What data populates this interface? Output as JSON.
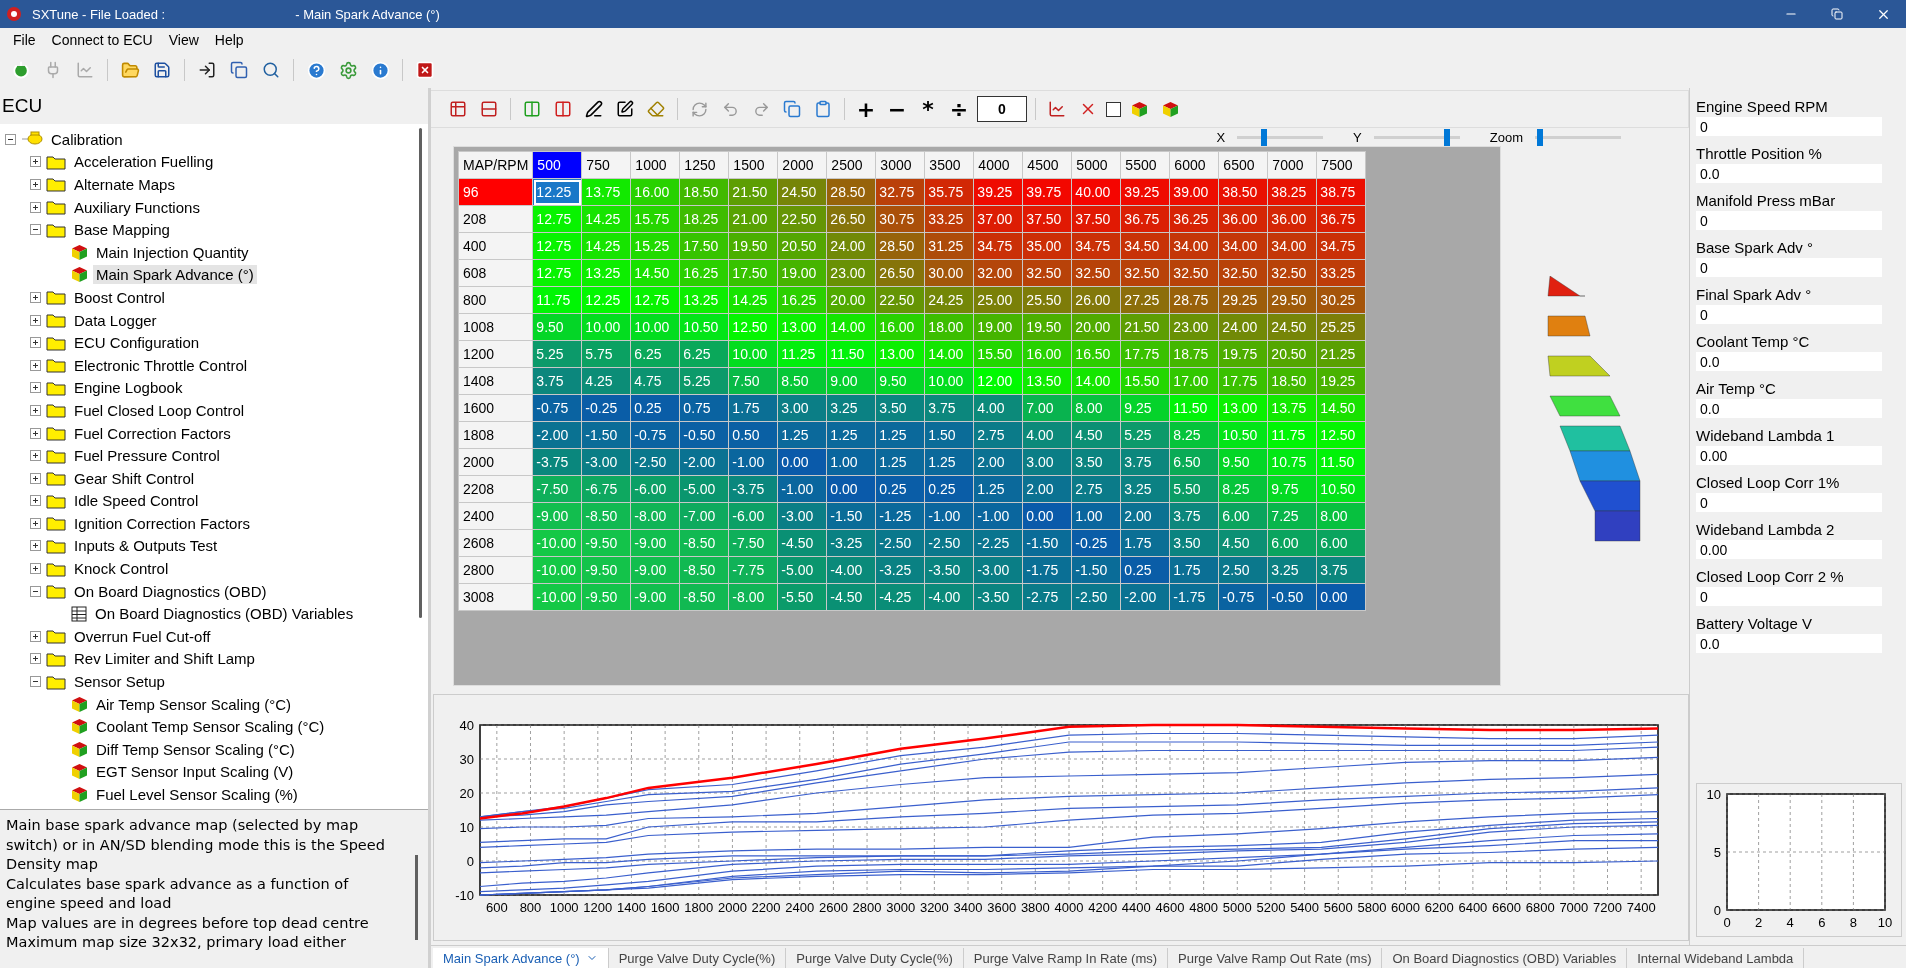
{
  "window": {
    "title": "SXTune - File Loaded :",
    "document": "- Main Spark Advance (°)"
  },
  "menu": [
    "File",
    "Connect to ECU",
    "View",
    "Help"
  ],
  "tree": {
    "title": "ECU",
    "items": [
      {
        "label": "Calibration",
        "kind": "root",
        "expanded": true,
        "selected": false,
        "children": [
          {
            "label": "Acceleration Fuelling",
            "kind": "folder",
            "expanded": false,
            "selected": false
          },
          {
            "label": "Alternate Maps",
            "kind": "folder",
            "expanded": false,
            "selected": false
          },
          {
            "label": "Auxiliary Functions",
            "kind": "folder",
            "expanded": false,
            "selected": false
          },
          {
            "label": "Base Mapping",
            "kind": "folder",
            "expanded": true,
            "selected": false,
            "children": [
              {
                "label": "Main Injection Quantity",
                "kind": "map",
                "selected": false
              },
              {
                "label": "Main Spark Advance (°)",
                "kind": "map",
                "selected": true
              }
            ]
          },
          {
            "label": "Boost Control",
            "kind": "folder",
            "expanded": false,
            "selected": false
          },
          {
            "label": "Data Logger",
            "kind": "folder",
            "expanded": false,
            "selected": false
          },
          {
            "label": "ECU Configuration",
            "kind": "folder",
            "expanded": false,
            "selected": false
          },
          {
            "label": "Electronic Throttle Control",
            "kind": "folder",
            "expanded": false,
            "selected": false
          },
          {
            "label": "Engine Logbook",
            "kind": "folder",
            "expanded": false,
            "selected": false
          },
          {
            "label": "Fuel Closed Loop Control",
            "kind": "folder",
            "expanded": false,
            "selected": false
          },
          {
            "label": "Fuel Correction Factors",
            "kind": "folder",
            "expanded": false,
            "selected": false
          },
          {
            "label": "Fuel Pressure Control",
            "kind": "folder",
            "expanded": false,
            "selected": false
          },
          {
            "label": "Gear Shift Control",
            "kind": "folder",
            "expanded": false,
            "selected": false
          },
          {
            "label": "Idle Speed Control",
            "kind": "folder",
            "expanded": false,
            "selected": false
          },
          {
            "label": "Ignition Correction Factors",
            "kind": "folder",
            "expanded": false,
            "selected": false
          },
          {
            "label": "Inputs & Outputs Test",
            "kind": "folder",
            "expanded": false,
            "selected": false
          },
          {
            "label": "Knock Control",
            "kind": "folder",
            "expanded": false,
            "selected": false
          },
          {
            "label": "On Board Diagnostics (OBD)",
            "kind": "folder",
            "expanded": true,
            "selected": false,
            "children": [
              {
                "label": "On Board Diagnostics (OBD) Variables",
                "kind": "table",
                "selected": false
              }
            ]
          },
          {
            "label": "Overrun Fuel Cut-off",
            "kind": "folder",
            "expanded": false,
            "selected": false
          },
          {
            "label": "Rev Limiter and Shift Lamp",
            "kind": "folder",
            "expanded": false,
            "selected": false
          },
          {
            "label": "Sensor Setup",
            "kind": "folder",
            "expanded": true,
            "selected": false,
            "children": [
              {
                "label": "Air Temp Sensor Scaling (°C)",
                "kind": "map",
                "selected": false
              },
              {
                "label": "Coolant Temp Sensor Scaling (°C)",
                "kind": "map",
                "selected": false
              },
              {
                "label": "Diff Temp Sensor Scaling (°C)",
                "kind": "map",
                "selected": false
              },
              {
                "label": "EGT Sensor Input Scaling (V)",
                "kind": "map",
                "selected": false
              },
              {
                "label": "Fuel Level Sensor Scaling (%)",
                "kind": "map",
                "selected": false
              }
            ]
          }
        ]
      }
    ]
  },
  "description": [
    "Main base spark advance map (selected by map switch) or in AN/SD blending mode this is the Speed Density map",
    "Calculates base spark advance as a function of engine speed and load",
    "Map values are in degrees before top dead centre",
    "Maximum map size 32x32, primary load either"
  ],
  "map_toolbar": {
    "operators": [
      "+",
      "−",
      "*",
      "÷"
    ],
    "value": "0",
    "checked": false
  },
  "view_sliders": [
    {
      "label": "X",
      "level": 0.3
    },
    {
      "label": "Y",
      "level": 0.88
    },
    {
      "label": "Zoom",
      "level": 0.02
    }
  ],
  "table": {
    "corner": "MAP/RPM",
    "columns": [
      {
        "label": "500",
        "selected": true
      },
      {
        "label": "750",
        "selected": false
      },
      {
        "label": "1000",
        "selected": false
      },
      {
        "label": "1250",
        "selected": false
      },
      {
        "label": "1500",
        "selected": false
      },
      {
        "label": "2000",
        "selected": false
      },
      {
        "label": "2500",
        "selected": false
      },
      {
        "label": "3000",
        "selected": false
      },
      {
        "label": "3500",
        "selected": false
      },
      {
        "label": "4000",
        "selected": false
      },
      {
        "label": "4500",
        "selected": false
      },
      {
        "label": "5000",
        "selected": false
      },
      {
        "label": "5500",
        "selected": false
      },
      {
        "label": "6000",
        "selected": false
      },
      {
        "label": "6500",
        "selected": false
      },
      {
        "label": "7000",
        "selected": false
      },
      {
        "label": "7500",
        "selected": false
      }
    ],
    "rows": [
      {
        "label": "96",
        "selected": true,
        "cells": [
          "12.25",
          "13.75",
          "16.00",
          "18.50",
          "21.50",
          "24.50",
          "28.50",
          "32.75",
          "35.75",
          "39.25",
          "39.75",
          "40.00",
          "39.25",
          "39.00",
          "38.50",
          "38.25",
          "38.75"
        ]
      },
      {
        "label": "208",
        "selected": false,
        "cells": [
          "12.75",
          "14.25",
          "15.75",
          "18.25",
          "21.00",
          "22.50",
          "26.50",
          "30.75",
          "33.25",
          "37.00",
          "37.50",
          "37.50",
          "36.75",
          "36.25",
          "36.00",
          "36.00",
          "36.75"
        ]
      },
      {
        "label": "400",
        "selected": false,
        "cells": [
          "12.75",
          "14.25",
          "15.25",
          "17.50",
          "19.50",
          "20.50",
          "24.00",
          "28.50",
          "31.25",
          "34.75",
          "35.00",
          "34.75",
          "34.50",
          "34.00",
          "34.00",
          "34.00",
          "34.75"
        ]
      },
      {
        "label": "608",
        "selected": false,
        "cells": [
          "12.75",
          "13.25",
          "14.50",
          "16.25",
          "17.50",
          "19.00",
          "23.00",
          "26.50",
          "30.00",
          "32.00",
          "32.50",
          "32.50",
          "32.50",
          "32.50",
          "32.50",
          "32.50",
          "33.25"
        ]
      },
      {
        "label": "800",
        "selected": false,
        "cells": [
          "11.75",
          "12.25",
          "12.75",
          "13.25",
          "14.25",
          "16.25",
          "20.00",
          "22.50",
          "24.25",
          "25.00",
          "25.50",
          "26.00",
          "27.25",
          "28.75",
          "29.25",
          "29.50",
          "30.25"
        ]
      },
      {
        "label": "1008",
        "selected": false,
        "cells": [
          "9.50",
          "10.00",
          "10.00",
          "10.50",
          "12.50",
          "13.00",
          "14.00",
          "16.00",
          "18.00",
          "19.00",
          "19.50",
          "20.00",
          "21.50",
          "23.00",
          "24.00",
          "24.50",
          "25.25"
        ]
      },
      {
        "label": "1200",
        "selected": false,
        "cells": [
          "5.25",
          "5.75",
          "6.25",
          "6.25",
          "10.00",
          "11.25",
          "11.50",
          "13.00",
          "14.00",
          "15.50",
          "16.00",
          "16.50",
          "17.75",
          "18.75",
          "19.75",
          "20.50",
          "21.25"
        ]
      },
      {
        "label": "1408",
        "selected": false,
        "cells": [
          "3.75",
          "4.25",
          "4.75",
          "5.25",
          "7.50",
          "8.50",
          "9.00",
          "9.50",
          "10.00",
          "12.00",
          "13.50",
          "14.00",
          "15.50",
          "17.00",
          "17.75",
          "18.50",
          "19.25"
        ]
      },
      {
        "label": "1600",
        "selected": false,
        "cells": [
          "-0.75",
          "-0.25",
          "0.25",
          "0.75",
          "1.75",
          "3.00",
          "3.25",
          "3.50",
          "3.75",
          "4.00",
          "7.00",
          "8.00",
          "9.25",
          "11.50",
          "13.00",
          "13.75",
          "14.50"
        ]
      },
      {
        "label": "1808",
        "selected": false,
        "cells": [
          "-2.00",
          "-1.50",
          "-0.75",
          "-0.50",
          "0.50",
          "1.25",
          "1.25",
          "1.25",
          "1.50",
          "2.75",
          "4.00",
          "4.50",
          "5.25",
          "8.25",
          "10.50",
          "11.75",
          "12.50"
        ]
      },
      {
        "label": "2000",
        "selected": false,
        "cells": [
          "-3.75",
          "-3.00",
          "-2.50",
          "-2.00",
          "-1.00",
          "0.00",
          "1.00",
          "1.25",
          "1.25",
          "2.00",
          "3.00",
          "3.50",
          "3.75",
          "6.50",
          "9.50",
          "10.75",
          "11.50"
        ]
      },
      {
        "label": "2208",
        "selected": false,
        "cells": [
          "-7.50",
          "-6.75",
          "-6.00",
          "-5.00",
          "-3.75",
          "-1.00",
          "0.00",
          "0.25",
          "0.25",
          "1.25",
          "2.00",
          "2.75",
          "3.25",
          "5.50",
          "8.25",
          "9.75",
          "10.50"
        ]
      },
      {
        "label": "2400",
        "selected": false,
        "cells": [
          "-9.00",
          "-8.50",
          "-8.00",
          "-7.00",
          "-6.00",
          "-3.00",
          "-1.50",
          "-1.25",
          "-1.00",
          "-1.00",
          "0.00",
          "1.00",
          "2.00",
          "3.75",
          "6.00",
          "7.25",
          "8.00"
        ]
      },
      {
        "label": "2608",
        "selected": false,
        "cells": [
          "-10.00",
          "-9.50",
          "-9.00",
          "-8.50",
          "-7.50",
          "-4.50",
          "-3.25",
          "-2.50",
          "-2.50",
          "-2.25",
          "-1.50",
          "-0.25",
          "1.75",
          "3.50",
          "4.50",
          "6.00",
          "6.00"
        ]
      },
      {
        "label": "2800",
        "selected": false,
        "cells": [
          "-10.00",
          "-9.50",
          "-9.00",
          "-8.50",
          "-7.75",
          "-5.00",
          "-4.00",
          "-3.25",
          "-3.50",
          "-3.00",
          "-1.75",
          "-1.50",
          "0.25",
          "1.75",
          "2.50",
          "3.25",
          "3.75"
        ]
      },
      {
        "label": "3008",
        "selected": false,
        "cells": [
          "-10.00",
          "-9.50",
          "-9.00",
          "-8.50",
          "-8.00",
          "-5.50",
          "-4.50",
          "-4.25",
          "-4.00",
          "-3.50",
          "-2.75",
          "-2.50",
          "-2.00",
          "-1.75",
          "-0.75",
          "-0.50",
          "0.00"
        ]
      }
    ]
  },
  "chart": {
    "chart_data": {
      "type": "line",
      "grid": true,
      "x": [
        500,
        750,
        1000,
        1250,
        1500,
        2000,
        2500,
        3000,
        3500,
        4000,
        4500,
        5000,
        5500,
        6000,
        6500,
        7000,
        7500
      ],
      "xlim": [
        500,
        7500
      ],
      "ylim": [
        -10,
        40
      ],
      "xticks": [
        600,
        800,
        1000,
        1200,
        1400,
        1600,
        1800,
        2000,
        2200,
        2400,
        2600,
        2800,
        3000,
        3200,
        3400,
        3600,
        3800,
        4000,
        4200,
        4400,
        4600,
        4800,
        5000,
        5200,
        5400,
        5600,
        5800,
        6000,
        6200,
        6400,
        6600,
        6800,
        7000,
        7200,
        7400
      ],
      "yticks": [
        -10,
        0,
        10,
        20,
        30,
        40
      ],
      "series": [
        {
          "color": "#ff0000",
          "values": [
            12.5,
            14,
            16,
            18.5,
            21.5,
            24.5,
            28.5,
            33,
            36,
            39.5,
            40,
            40,
            39.5,
            39,
            38.5,
            38.5,
            39
          ]
        },
        {
          "color": "#3a5fcd",
          "values": [
            13,
            14.5,
            16,
            18.5,
            21,
            22.5,
            26.5,
            31,
            33.5,
            37,
            37.5,
            37.5,
            37,
            36.5,
            36,
            36,
            37
          ]
        },
        {
          "color": "#3a5fcd",
          "values": [
            13,
            14.5,
            15.5,
            17.5,
            19.5,
            20.5,
            24,
            28.5,
            31.5,
            35,
            35,
            35,
            34.5,
            34,
            34,
            34,
            35
          ]
        },
        {
          "color": "#3a5fcd",
          "values": [
            13,
            13.5,
            14.5,
            16.5,
            17.5,
            19,
            23,
            26.5,
            30,
            32,
            32.5,
            32.5,
            32.5,
            32.5,
            32.5,
            32.5,
            33.5
          ]
        },
        {
          "color": "#3a5fcd",
          "values": [
            12,
            12.5,
            13,
            13.5,
            14.5,
            16.5,
            20,
            22.5,
            24.5,
            25,
            25.5,
            26,
            27.5,
            29,
            29.5,
            29.5,
            30.5
          ]
        },
        {
          "color": "#3a5fcd",
          "values": [
            9.5,
            10,
            10,
            10.5,
            12.5,
            13,
            14,
            16,
            18,
            19,
            19.5,
            20,
            21.5,
            23,
            24,
            24.5,
            25.5
          ]
        },
        {
          "color": "#3a5fcd",
          "values": [
            5.5,
            6,
            6.5,
            6.5,
            10,
            11.5,
            11.5,
            13,
            14,
            15.5,
            16,
            16.5,
            18,
            19,
            20,
            20.5,
            21.5
          ]
        },
        {
          "color": "#3a5fcd",
          "values": [
            4,
            4.5,
            5,
            5.5,
            7.5,
            8.5,
            9,
            9.5,
            10,
            12,
            13.5,
            14,
            15.5,
            17,
            18,
            18.5,
            19.5
          ]
        },
        {
          "color": "#3a5fcd",
          "values": [
            -0.5,
            0,
            0.5,
            1,
            2,
            3,
            3.5,
            3.5,
            4,
            4,
            7,
            8,
            9.5,
            11.5,
            13,
            14,
            14.5
          ]
        },
        {
          "color": "#3a5fcd",
          "values": [
            -2,
            -1.5,
            -0.5,
            -0.5,
            0.5,
            1.5,
            1.5,
            1.5,
            1.5,
            3,
            4,
            4.5,
            5.5,
            8.5,
            10.5,
            12,
            12.5
          ]
        },
        {
          "color": "#3a5fcd",
          "values": [
            -3.5,
            -3,
            -2.5,
            -2,
            -1,
            0,
            1,
            1.5,
            1.5,
            2,
            3,
            3.5,
            4,
            6.5,
            9.5,
            11,
            11.5
          ]
        },
        {
          "color": "#3a5fcd",
          "values": [
            -7.5,
            -6.5,
            -6,
            -5,
            -3.5,
            -1,
            0,
            0.5,
            0.5,
            1.5,
            2,
            3,
            3.5,
            5.5,
            8.5,
            10,
            10.5
          ]
        },
        {
          "color": "#3a5fcd",
          "values": [
            -9,
            -8.5,
            -8,
            -7,
            -6,
            -3,
            -1.5,
            -1,
            -1,
            -1,
            0,
            1,
            2,
            4,
            6,
            7.5,
            8
          ]
        },
        {
          "color": "#3a5fcd",
          "values": [
            -10,
            -9.5,
            -9,
            -8.5,
            -7.5,
            -4.5,
            -3,
            -2.5,
            -2.5,
            -2,
            -1.5,
            0,
            2,
            3.5,
            4.5,
            6,
            6
          ]
        },
        {
          "color": "#3a5fcd",
          "values": [
            -10,
            -9.5,
            -9,
            -8.5,
            -7.5,
            -5,
            -4,
            -3,
            -3.5,
            -3,
            -1.5,
            -1.5,
            0.5,
            2,
            2.5,
            3.5,
            4
          ]
        },
        {
          "color": "#3a5fcd",
          "values": [
            -10,
            -9.5,
            -9,
            -8.5,
            -8,
            -5.5,
            -4.5,
            -4,
            -4,
            -3.5,
            -2.5,
            -2.5,
            -2,
            -1.5,
            -0.5,
            -0.5,
            0
          ]
        }
      ]
    }
  },
  "gauges": [
    {
      "label": "Engine Speed RPM",
      "value": "0"
    },
    {
      "label": "Throttle Position %",
      "value": "0.0"
    },
    {
      "label": "Manifold Press mBar",
      "value": "0"
    },
    {
      "label": "Base Spark Adv °",
      "value": "0"
    },
    {
      "label": "Final Spark Adv °",
      "value": "0"
    },
    {
      "label": "Coolant Temp °C",
      "value": "0.0"
    },
    {
      "label": "Air Temp °C",
      "value": "0.0"
    },
    {
      "label": "Wideband Lambda 1",
      "value": "0.00"
    },
    {
      "label": "Closed Loop Corr 1%",
      "value": "0"
    },
    {
      "label": "Wideband Lambda 2",
      "value": "0.00"
    },
    {
      "label": "Closed Loop Corr 2 %",
      "value": "0"
    },
    {
      "label": "Battery Voltage V",
      "value": "0.0"
    }
  ],
  "mini_chart": {
    "chart_data": {
      "type": "line",
      "grid": true,
      "xlim": [
        0,
        10
      ],
      "ylim": [
        0,
        10
      ],
      "xticks": [
        0,
        2,
        4,
        6,
        8,
        10
      ],
      "yticks": [
        0,
        5,
        10
      ]
    }
  },
  "bottom_tabs": [
    {
      "label": "Main Spark Advance (°)",
      "selected": true
    },
    {
      "label": "Purge Valve Duty Cycle(%)",
      "selected": false
    },
    {
      "label": "Purge Valve Duty Cycle(%)",
      "selected": false
    },
    {
      "label": "Purge Valve Ramp In Rate (ms)",
      "selected": false
    },
    {
      "label": "Purge Valve Ramp Out Rate (ms)",
      "selected": false
    },
    {
      "label": "On Board Diagnostics (OBD) Variables",
      "selected": false
    },
    {
      "label": "Internal Wideband Lambda",
      "selected": false
    }
  ]
}
